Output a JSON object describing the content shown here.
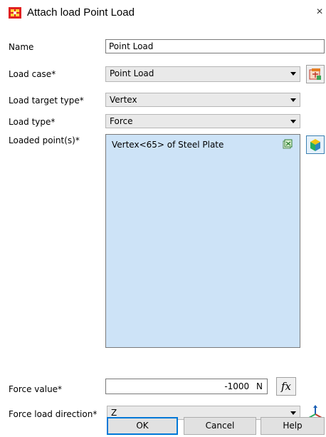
{
  "window": {
    "title": "Attach load Point Load",
    "close_glyph": "×"
  },
  "form": {
    "name_label": "Name",
    "name_value": "Point Load",
    "load_case_label": "Load case*",
    "load_case_value": "Point Load",
    "load_target_label": "Load target type*",
    "load_target_value": "Vertex",
    "load_type_label": "Load type*",
    "load_type_value": "Force",
    "loaded_points_label": "Loaded point(s)*",
    "loaded_points": [
      "Vertex<65> of Steel Plate"
    ],
    "force_value_label": "Force value*",
    "force_value": "-1000",
    "force_unit": "N",
    "fx_label": "fx",
    "direction_label": "Force load direction*",
    "direction_value": "Z"
  },
  "buttons": {
    "ok": "OK",
    "cancel": "Cancel",
    "help": "Help"
  },
  "icons": {
    "app": "app-logo-icon",
    "load_case": "load-case-icon",
    "clear": "clear-selection-icon",
    "select": "select-3d-icon",
    "axis": "axis-direction-icon"
  },
  "colors": {
    "list_background": "#cde3f7",
    "accent": "#0078d7",
    "app_logo": "#e02020"
  }
}
